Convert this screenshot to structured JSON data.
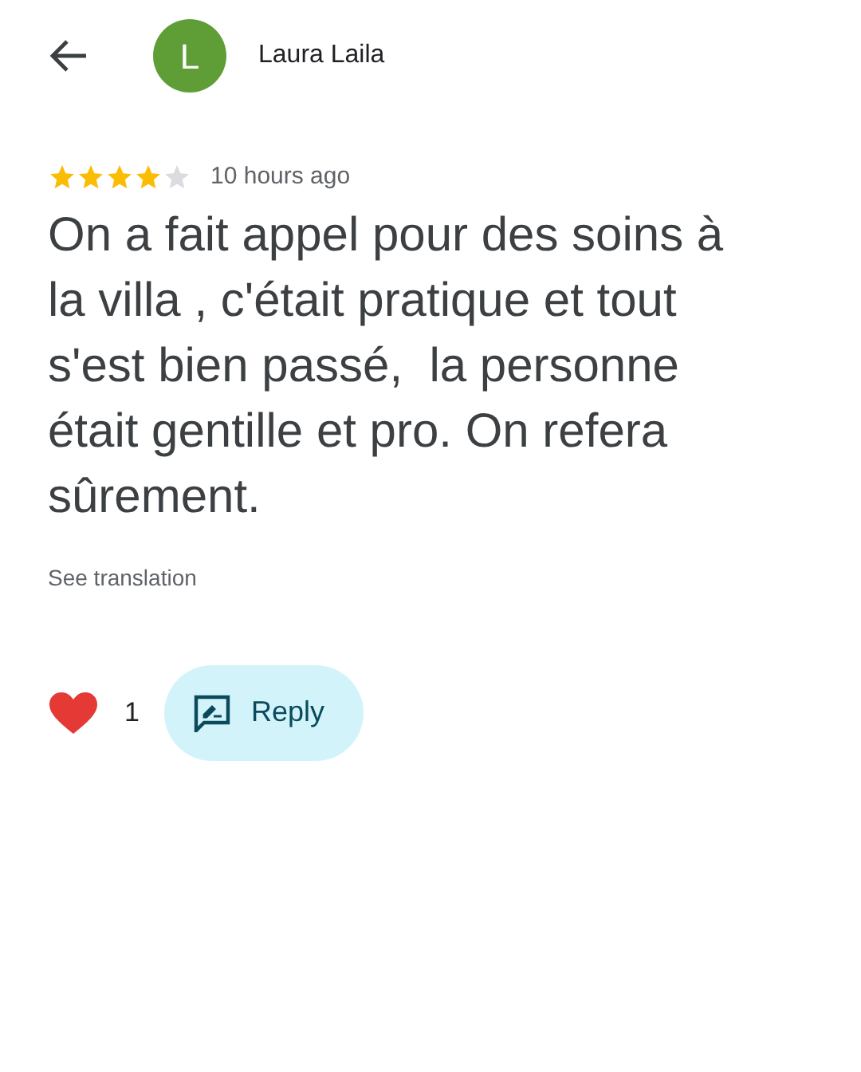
{
  "header": {
    "avatar_letter": "L",
    "author": "Laura Laila"
  },
  "review": {
    "stars": 4,
    "time": "10 hours ago",
    "text": "On a fait appel pour des soins à la villa , c'était pratique et tout s'est bien passé,  la personne était gentille et pro. On refera sûrement.",
    "translation_link": "See translation"
  },
  "actions": {
    "like_count": "1",
    "reply_label": "Reply"
  }
}
